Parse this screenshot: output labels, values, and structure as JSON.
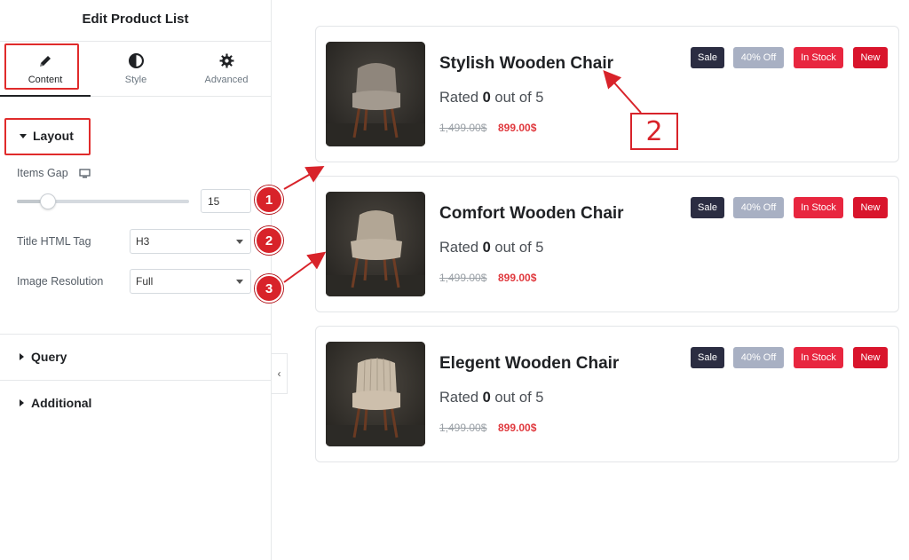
{
  "sidebar": {
    "title": "Edit Product List",
    "tabs": [
      {
        "label": "Content",
        "icon": "pencil-icon"
      },
      {
        "label": "Style",
        "icon": "half-circle-icon"
      },
      {
        "label": "Advanced",
        "icon": "gear-icon"
      }
    ],
    "layout_section": {
      "title": "Layout",
      "items_gap_label": "Items Gap",
      "items_gap_value": "15",
      "items_gap_fraction": 0.15,
      "title_tag_label": "Title HTML Tag",
      "title_tag_value": "H3",
      "image_res_label": "Image Resolution",
      "image_res_value": "Full"
    },
    "query_title": "Query",
    "additional_title": "Additional",
    "collapse_glyph": "‹"
  },
  "markers": [
    "1",
    "2",
    "3"
  ],
  "callout": "2",
  "badges": {
    "sale": "Sale",
    "discount": "40% Off",
    "stock": "In Stock",
    "new": "New"
  },
  "colors": {
    "sale": "#2b2d42",
    "discount": "#a8b0c3",
    "stock": "#e8263f",
    "new": "#d9152c",
    "accent_red": "#d8232a",
    "price": "#e0393e"
  },
  "products": [
    {
      "title": "Stylish Wooden Chair",
      "rating_prefix": "Rated ",
      "rating_value": "0",
      "rating_suffix": " out of 5",
      "old_price": "1,499.00$",
      "new_price": "899.00$"
    },
    {
      "title": "Comfort Wooden Chair",
      "rating_prefix": "Rated ",
      "rating_value": "0",
      "rating_suffix": " out of 5",
      "old_price": "1,499.00$",
      "new_price": "899.00$"
    },
    {
      "title": "Elegent Wooden Chair",
      "rating_prefix": "Rated ",
      "rating_value": "0",
      "rating_suffix": " out of 5",
      "old_price": "1,499.00$",
      "new_price": "899.00$"
    }
  ]
}
